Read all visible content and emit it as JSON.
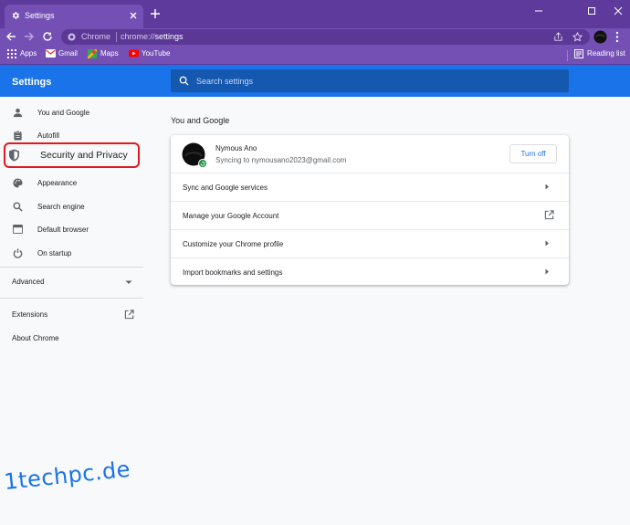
{
  "window": {
    "tab_title": "Settings",
    "controls": [
      "minimize-icon",
      "maximize-icon",
      "close-icon"
    ]
  },
  "toolbar": {
    "site_chip": "Chrome",
    "url_scheme": "chrome://",
    "url_path": "settings"
  },
  "bookmarks": {
    "items": [
      {
        "label": "Apps",
        "icon": "apps-grid-icon"
      },
      {
        "label": "Gmail",
        "icon": "gmail-icon"
      },
      {
        "label": "Maps",
        "icon": "maps-icon"
      },
      {
        "label": "YouTube",
        "icon": "youtube-icon"
      }
    ],
    "reading_list": "Reading list"
  },
  "settings": {
    "title": "Settings",
    "search_placeholder": "Search settings"
  },
  "sidebar": {
    "items": [
      {
        "label": "You and Google",
        "icon": "person-icon"
      },
      {
        "label": "Autofill",
        "icon": "clipboard-icon"
      },
      {
        "label": "Security and Privacy",
        "icon": "shield-icon"
      },
      {
        "label": "Appearance",
        "icon": "palette-icon"
      },
      {
        "label": "Search engine",
        "icon": "search-icon"
      },
      {
        "label": "Default browser",
        "icon": "browser-icon"
      },
      {
        "label": "On startup",
        "icon": "power-icon"
      }
    ],
    "advanced": "Advanced",
    "extensions": "Extensions",
    "about": "About Chrome"
  },
  "main": {
    "section_title": "You and Google",
    "account": {
      "name": "Nymous Ano",
      "email": "Syncing to nymousano2023@gmail.com",
      "turn_off": "Turn off"
    },
    "rows": [
      {
        "label": "Sync and Google services",
        "icon": "chevron-right-icon"
      },
      {
        "label": "Manage your Google Account",
        "icon": "open-external-icon"
      },
      {
        "label": "Customize your Chrome profile",
        "icon": "chevron-right-icon"
      },
      {
        "label": "Import bookmarks and settings",
        "icon": "chevron-right-icon"
      }
    ]
  },
  "watermark": "1techpc.de",
  "colors": {
    "titlebar": "#5d3a9b",
    "toolbar": "#7450b5",
    "accent": "#1a73e8",
    "highlight": "#e0191f"
  }
}
